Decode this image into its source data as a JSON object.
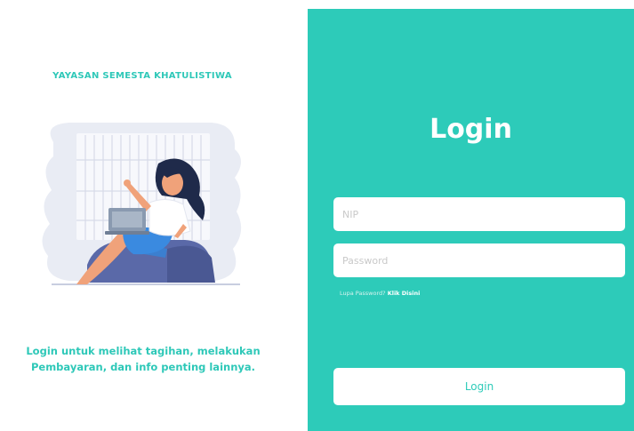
{
  "left": {
    "org_name": "YAYASAN SEMESTA KHATULISTIWA",
    "tagline_line1": "Login untuk melihat tagihan, melakukan",
    "tagline_line2": "Pembayaran, dan info penting lainnya."
  },
  "form": {
    "title": "Login",
    "nip_placeholder": "NIP",
    "password_placeholder": "Password",
    "forgot_text": "Lupa Password? ",
    "forgot_link": "Klik Disini",
    "login_button": "Login"
  },
  "colors": {
    "accent": "#2dcbb9",
    "skin": "#f0a27a",
    "hair": "#1f2a4a",
    "laptop": "#8a9ab0",
    "window": "#e6e9f2"
  }
}
